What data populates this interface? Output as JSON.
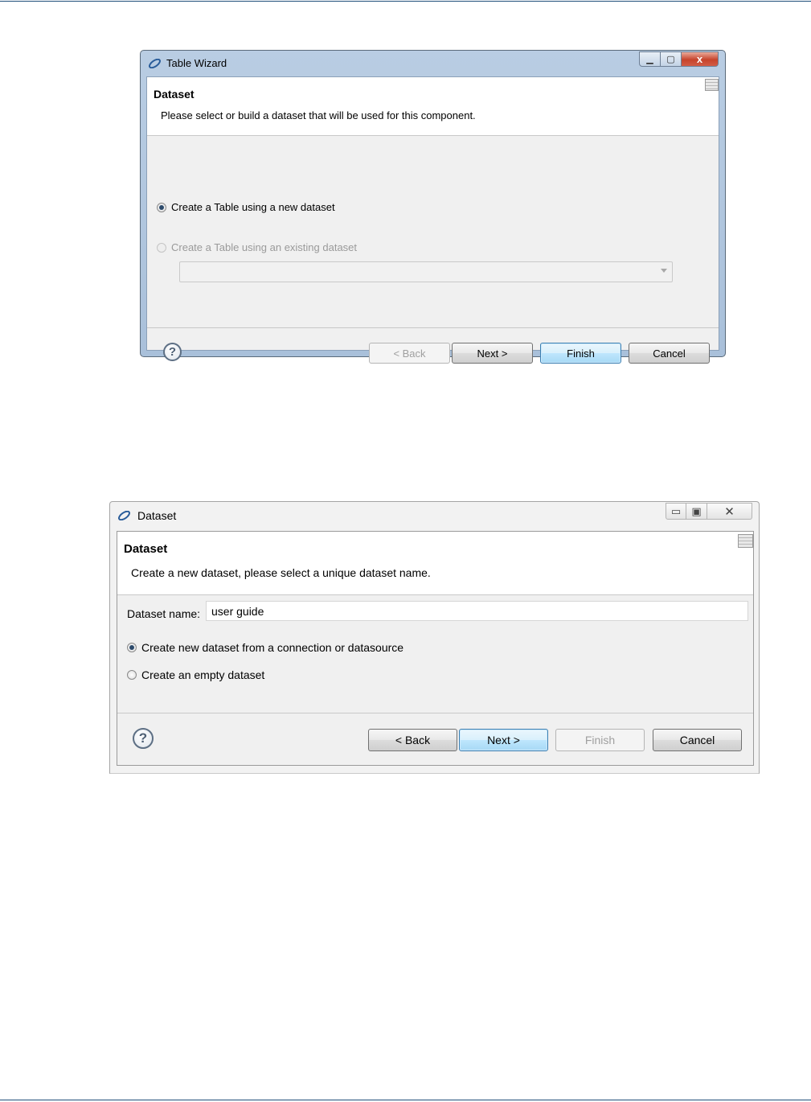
{
  "colors": {
    "page_rule": "#1f4e79",
    "default_button_border": "#3c7fb1"
  },
  "table_wizard": {
    "window_title": "Table Wizard",
    "title_icon": "eclipse-logo-icon",
    "window_controls": {
      "minimize": "▁",
      "maximize": "▢",
      "close": "x"
    },
    "banner": {
      "title": "Dataset",
      "description": "Please select or build a dataset that will be used for this component."
    },
    "options": [
      {
        "label": "Create a Table using a new dataset",
        "selected": true,
        "enabled": true
      },
      {
        "label": "Create a Table using an existing dataset",
        "selected": false,
        "enabled": false
      }
    ],
    "dataset_combo_value": "",
    "buttons": {
      "back": "< Back",
      "next": "Next >",
      "finish": "Finish",
      "cancel": "Cancel"
    },
    "help": "?"
  },
  "dataset_dialog": {
    "window_title": "Dataset",
    "title_icon": "eclipse-logo-icon",
    "window_controls": {
      "minimize": "▭",
      "maximize": "▣",
      "close": "✕"
    },
    "banner": {
      "title": "Dataset",
      "description": "Create a new dataset, please select a unique dataset name."
    },
    "name_label": "Dataset name:",
    "name_value": "user guide",
    "options": [
      {
        "label": "Create new dataset from a connection or datasource",
        "selected": true
      },
      {
        "label": "Create an empty dataset",
        "selected": false
      }
    ],
    "buttons": {
      "back": "< Back",
      "next": "Next >",
      "finish": "Finish",
      "cancel": "Cancel"
    },
    "help": "?"
  }
}
